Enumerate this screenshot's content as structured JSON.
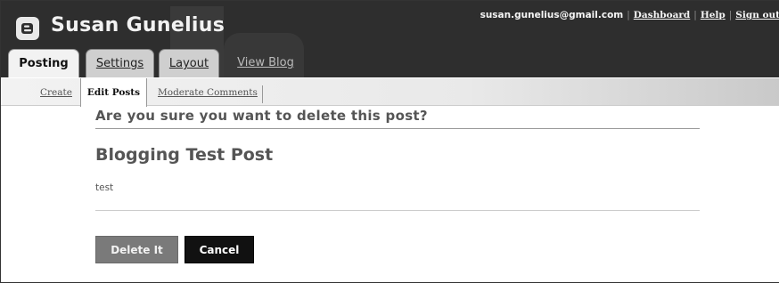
{
  "header": {
    "blog_title": "Susan Gunelius",
    "email": "susan.gunelius@gmail.com",
    "links": {
      "dashboard": "Dashboard",
      "help": "Help",
      "sign_out": "Sign out"
    },
    "separator": "|",
    "logo_icon": "blogger-logo-icon"
  },
  "tabs": {
    "posting": "Posting",
    "settings": "Settings",
    "layout": "Layout",
    "view_blog": "View Blog"
  },
  "subnav": {
    "create": "Create",
    "edit_posts": "Edit Posts",
    "moderate_comments": "Moderate Comments"
  },
  "main": {
    "confirm_heading": "Are you sure you want to delete this post?",
    "post_title": "Blogging Test Post",
    "post_body": "test",
    "delete_label": "Delete It",
    "cancel_label": "Cancel"
  },
  "colors": {
    "header_bg": "#2e2e2e",
    "delete_button": "#7a7a7a",
    "cancel_button": "#111111"
  }
}
